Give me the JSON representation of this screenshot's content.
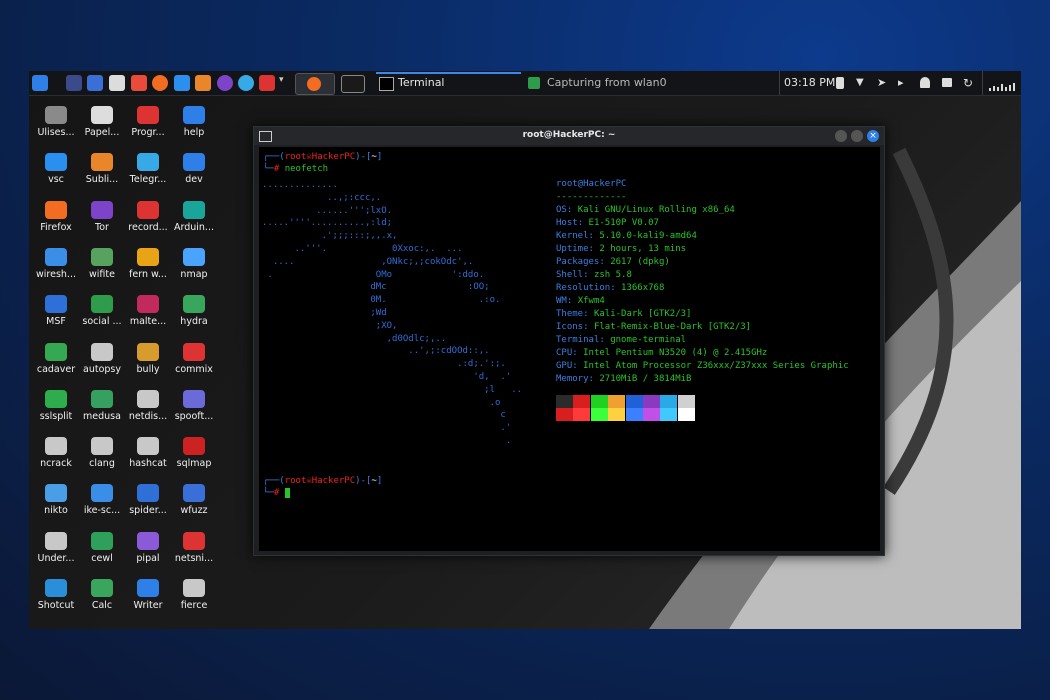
{
  "panel": {
    "clock": "03:18 PM",
    "tasks": [
      {
        "label": "Terminal",
        "active": true
      },
      {
        "label": "Capturing from wlan0",
        "active": false
      }
    ]
  },
  "desktop_icons": [
    {
      "label": "Ulises...",
      "icon": "app-icon",
      "color": "#8a8a8a"
    },
    {
      "label": "Papel...",
      "icon": "trash-icon",
      "color": "#dddddd"
    },
    {
      "label": "Progr...",
      "icon": "program-icon",
      "color": "#d33"
    },
    {
      "label": "help",
      "icon": "folder-icon",
      "color": "#2f7fe8"
    },
    {
      "label": "vsc",
      "icon": "vscode-icon",
      "color": "#2b8ff0"
    },
    {
      "label": "Subli...",
      "icon": "sublime-icon",
      "color": "#e9862a"
    },
    {
      "label": "Telegr...",
      "icon": "telegram-icon",
      "color": "#37a9e6"
    },
    {
      "label": "dev",
      "icon": "folder-icon",
      "color": "#2f7fe8"
    },
    {
      "label": "Firefox",
      "icon": "firefox-icon",
      "color": "#f26c22"
    },
    {
      "label": "Tor",
      "icon": "tor-icon",
      "color": "#7d43c8"
    },
    {
      "label": "record...",
      "icon": "record-icon",
      "color": "#d33"
    },
    {
      "label": "Arduin...",
      "icon": "arduino-icon",
      "color": "#19a59a"
    },
    {
      "label": "wiresh...",
      "icon": "wireshark-icon",
      "color": "#3b8ee8"
    },
    {
      "label": "wifite",
      "icon": "wifite-icon",
      "color": "#57a25f"
    },
    {
      "label": "fern w...",
      "icon": "fern-icon",
      "color": "#e8a317"
    },
    {
      "label": "nmap",
      "icon": "eye-icon",
      "color": "#4aa3ff"
    },
    {
      "label": "MSF",
      "icon": "metasploit-icon",
      "color": "#2f6fd8"
    },
    {
      "label": "social ...",
      "icon": "social-icon",
      "color": "#2e9c4a"
    },
    {
      "label": "malte...",
      "icon": "maltego-icon",
      "color": "#c22a5e"
    },
    {
      "label": "hydra",
      "icon": "hydra-icon",
      "color": "#3aa55d"
    },
    {
      "label": "cadaver",
      "icon": "cadaver-icon",
      "color": "#36a852"
    },
    {
      "label": "autopsy",
      "icon": "autopsy-icon",
      "color": "#c8c8c8"
    },
    {
      "label": "bully",
      "icon": "bully-icon",
      "color": "#d89c2e"
    },
    {
      "label": "commix",
      "icon": "commix-icon",
      "color": "#d33"
    },
    {
      "label": "sslsplit",
      "icon": "ssl-icon",
      "color": "#2eac4e"
    },
    {
      "label": "medusa",
      "icon": "medusa-icon",
      "color": "#36a060"
    },
    {
      "label": "netdis...",
      "icon": "netdis-icon",
      "color": "#c8c8c8"
    },
    {
      "label": "spooft...",
      "icon": "spoof-icon",
      "color": "#6a6ad8"
    },
    {
      "label": "ncrack",
      "icon": "ncrack-icon",
      "color": "#c8c8c8"
    },
    {
      "label": "clang",
      "icon": "clang-icon",
      "color": "#c8c8c8"
    },
    {
      "label": "hashcat",
      "icon": "hashcat-icon",
      "color": "#c8c8c8"
    },
    {
      "label": "sqlmap",
      "icon": "sqlmap-icon",
      "color": "#c22"
    },
    {
      "label": "nikto",
      "icon": "alien-icon",
      "color": "#4a9ee8"
    },
    {
      "label": "ike-sc...",
      "icon": "fingerprint-icon",
      "color": "#3a8ee8"
    },
    {
      "label": "spider...",
      "icon": "spider-icon",
      "color": "#2e6fd8"
    },
    {
      "label": "wfuzz",
      "icon": "wfuzz-icon",
      "color": "#3a6fd8"
    },
    {
      "label": "Under...",
      "icon": "hat-icon",
      "color": "#c8c8c8"
    },
    {
      "label": "cewl",
      "icon": "cewl-icon",
      "color": "#2ea05a"
    },
    {
      "label": "pipal",
      "icon": "pipal-icon",
      "color": "#8a5ad8"
    },
    {
      "label": "netsni...",
      "icon": "netsniff-icon",
      "color": "#d33"
    },
    {
      "label": "Shotcut",
      "icon": "shotcut-icon",
      "color": "#2a8fd8"
    },
    {
      "label": "Calc",
      "icon": "calc-icon",
      "color": "#3aa55d"
    },
    {
      "label": "Writer",
      "icon": "writer-icon",
      "color": "#2f7fe8"
    },
    {
      "label": "fierce",
      "icon": "fierce-icon",
      "color": "#c8c8c8"
    }
  ],
  "terminal": {
    "title": "root@HackerPC: ~",
    "prompt_user": "root",
    "prompt_host": "HackerPC",
    "prompt_dir": "~",
    "command": "neofetch",
    "user_host": "root@HackerPC",
    "separator": "-------------",
    "info": [
      {
        "key": "OS",
        "value": "Kali GNU/Linux Rolling x86_64"
      },
      {
        "key": "Host",
        "value": "E1-510P V0.07"
      },
      {
        "key": "Kernel",
        "value": "5.10.0-kali9-amd64"
      },
      {
        "key": "Uptime",
        "value": "2 hours, 13 mins"
      },
      {
        "key": "Packages",
        "value": "2617 (dpkg)"
      },
      {
        "key": "Shell",
        "value": "zsh 5.8"
      },
      {
        "key": "Resolution",
        "value": "1366x768"
      },
      {
        "key": "WM",
        "value": "Xfwm4"
      },
      {
        "key": "Theme",
        "value": "Kali-Dark [GTK2/3]"
      },
      {
        "key": "Icons",
        "value": "Flat-Remix-Blue-Dark [GTK2/3]"
      },
      {
        "key": "Terminal",
        "value": "gnome-terminal"
      },
      {
        "key": "CPU",
        "value": "Intel Pentium N3520 (4) @ 2.415GHz"
      },
      {
        "key": "GPU",
        "value": "Intel Atom Processor Z36xxx/Z37xxx Series Graphic"
      },
      {
        "key": "Memory",
        "value": "2710MiB / 3814MiB"
      }
    ],
    "logo_lines": [
      "..............",
      "            ..,;:ccc,.",
      "          ......''';lxO.",
      ".....''''..........,:ld;",
      "           .';;;:::;,,.x,",
      "      ..'''.            0Xxoc:,.  ...",
      "  ....                ,ONkc;,;cokOdc',.",
      " .                   OMo           ':ddo.",
      "                    dMc               :OO;",
      "                    0M.                 .:o.",
      "                    ;Wd",
      "                     ;XO,",
      "                       ,d0Odlc;,..",
      "                           ..',;:cdOOd::,.",
      "                                    .:d;.':;.",
      "                                       'd,  .'",
      "                                         ;l   ..",
      "                                          .o",
      "                                            c",
      "                                            .'",
      "                                             ."
    ],
    "palette_top": [
      "#2b2b2b",
      "#d81e1e",
      "#21d121",
      "#f0a030",
      "#2060d8",
      "#8a3ac0",
      "#29a9e8",
      "#d0d0d0"
    ],
    "palette_bottom": [
      "#d81e1e",
      "#ff3a3a",
      "#3aff3a",
      "#ffd040",
      "#3a80ff",
      "#c050e8",
      "#40c8ff",
      "#ffffff"
    ]
  }
}
